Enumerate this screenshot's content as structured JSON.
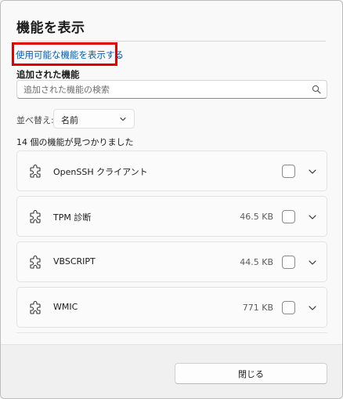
{
  "dialog": {
    "title": "機能を表示",
    "show_available_link": "使用可能な機能を表示する",
    "installed_label": "追加された機能",
    "search": {
      "placeholder": "追加された機能の検索",
      "value": ""
    },
    "sort": {
      "label": "並べ替え:",
      "selected": "名前"
    },
    "count_text": "14 個の機能が見つかりました",
    "features": [
      {
        "name": "OpenSSH クライアント",
        "size": ""
      },
      {
        "name": "TPM 診断",
        "size": "46.5 KB"
      },
      {
        "name": "VBSCRIPT",
        "size": "44.5 KB"
      },
      {
        "name": "WMIC",
        "size": "771 KB"
      }
    ],
    "close_label": "閉じる"
  },
  "colors": {
    "link": "#005fb8",
    "highlight_box": "#e00000"
  }
}
